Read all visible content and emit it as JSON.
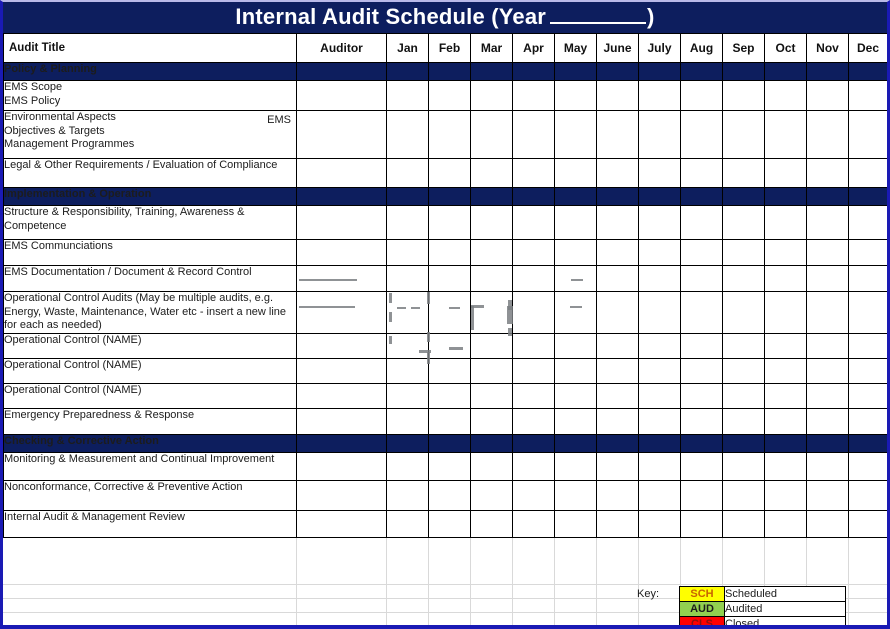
{
  "title": {
    "prefix": "Internal Audit Schedule (Year",
    "suffix": ")"
  },
  "columns": {
    "audit_title": "Audit Title",
    "auditor": "Auditor",
    "months": [
      "Jan",
      "Feb",
      "Mar",
      "Apr",
      "May",
      "June",
      "July",
      "Aug",
      "Sep",
      "Oct",
      "Nov",
      "Dec"
    ]
  },
  "sections": [
    {
      "name": "Policy & Planning",
      "rows": [
        {
          "label": "EMS Scope\nEMS Policy",
          "tag": ""
        },
        {
          "label": "Environmental Aspects\nObjectives & Targets\nManagement Programmes",
          "tag": "EMS"
        },
        {
          "label": "Legal & Other Requirements / Evaluation of Compliance",
          "tag": ""
        }
      ]
    },
    {
      "name": "Implementation & Operation",
      "rows": [
        {
          "label": "Structure & Responsibility, Training, Awareness &\nCompetence",
          "tag": ""
        },
        {
          "label": "EMS Communciations",
          "tag": ""
        },
        {
          "label": "EMS Documentation / Document & Record Control",
          "tag": ""
        },
        {
          "label": "Operational Control Audits (May be multiple audits, e.g.\nEnergy, Waste, Maintenance, Water etc - insert a new line\nfor each as needed)",
          "tag": ""
        },
        {
          "label": "Operational Control (NAME)",
          "tag": ""
        },
        {
          "label": "Operational Control (NAME)",
          "tag": ""
        },
        {
          "label": "Operational Control (NAME)",
          "tag": ""
        },
        {
          "label": "Emergency Preparedness & Response",
          "tag": ""
        }
      ]
    },
    {
      "name": "Checking & Corrective Action",
      "rows": [
        {
          "label": "Monitoring & Measurement and Continual Improvement",
          "tag": ""
        },
        {
          "label": "Nonconformance, Corrective & Preventive Action",
          "tag": ""
        },
        {
          "label": "Internal Audit & Management Review",
          "tag": ""
        }
      ]
    }
  ],
  "key": {
    "label": "Key:",
    "entries": [
      {
        "code": "SCH",
        "desc": "Scheduled",
        "bg": "#ffff00",
        "fg": "#c86400"
      },
      {
        "code": "AUD",
        "desc": "Audited",
        "bg": "#92d050",
        "fg": "#1c1c1c"
      },
      {
        "code": "CLS",
        "desc": "Closed",
        "bg": "#ff0000",
        "fg": "#8b1111"
      }
    ]
  },
  "colors": {
    "header_band": "#0d1e5e",
    "outer_border": "#1a1ab4",
    "grid_line": "#000000",
    "faint_grid": "#d9d9d9"
  }
}
